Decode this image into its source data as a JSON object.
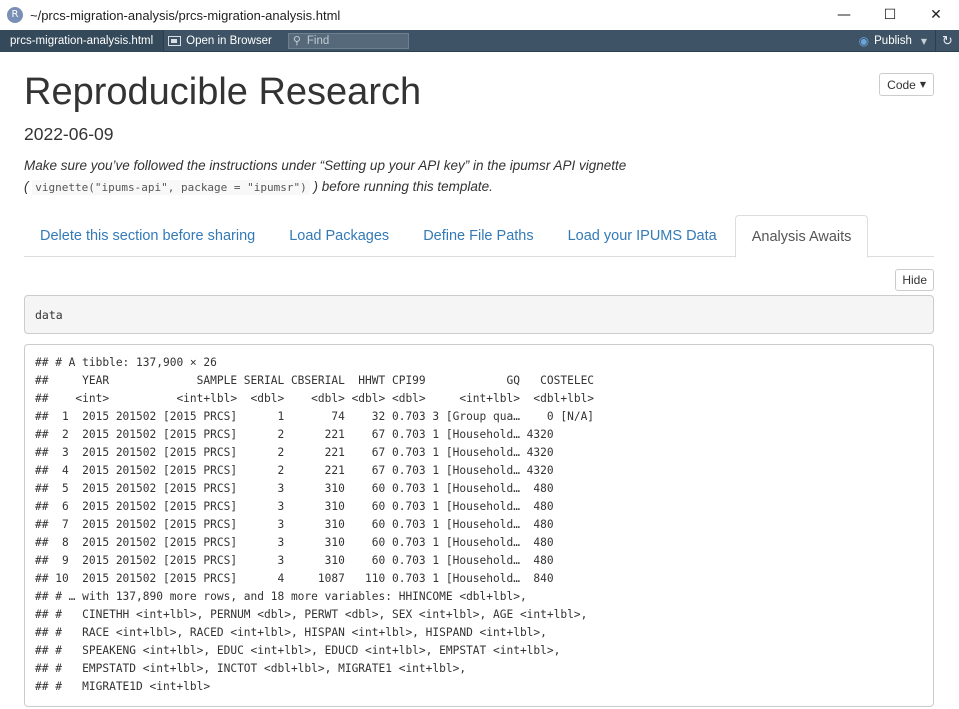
{
  "window": {
    "title": "~/prcs-migration-analysis/prcs-migration-analysis.html",
    "app_icon": "R",
    "minimize": "—",
    "maximize": "☐",
    "close": "✕"
  },
  "toolbar": {
    "file_tab": "prcs-migration-analysis.html",
    "open_in_browser": "Open in Browser",
    "find_placeholder": "Find",
    "publish": "Publish",
    "icons": {
      "open": "window-icon",
      "search": "search-icon",
      "publish": "publish-icon",
      "refresh": "refresh-icon"
    }
  },
  "document": {
    "title": "Reproducible Research",
    "date": "2022-06-09",
    "code_button": "Code",
    "note_before": "Make sure you’ve followed the instructions under “Setting up your API key” in the ipumsr API vignette",
    "note_open": "( ",
    "note_code": "vignette(\"ipums-api\", package = \"ipumsr\")",
    "note_after": " ) before running this template.",
    "tabs": [
      {
        "label": "Delete this section before sharing",
        "active": false
      },
      {
        "label": "Load Packages",
        "active": false
      },
      {
        "label": "Define File Paths",
        "active": false
      },
      {
        "label": "Load your IPUMS Data",
        "active": false
      },
      {
        "label": "Analysis Awaits",
        "active": true
      }
    ],
    "hide_button": "Hide",
    "code_chunk": "data",
    "output_lines": [
      "## # A tibble: 137,900 × 26",
      "##     YEAR             SAMPLE SERIAL CBSERIAL  HHWT CPI99            GQ   COSTELEC",
      "##    <int>          <int+lbl>  <dbl>    <dbl> <dbl> <dbl>     <int+lbl>  <dbl+lbl>",
      "##  1  2015 201502 [2015 PRCS]      1       74    32 0.703 3 [Group qua…    0 [N/A]",
      "##  2  2015 201502 [2015 PRCS]      2      221    67 0.703 1 [Household… 4320",
      "##  3  2015 201502 [2015 PRCS]      2      221    67 0.703 1 [Household… 4320",
      "##  4  2015 201502 [2015 PRCS]      2      221    67 0.703 1 [Household… 4320",
      "##  5  2015 201502 [2015 PRCS]      3      310    60 0.703 1 [Household…  480",
      "##  6  2015 201502 [2015 PRCS]      3      310    60 0.703 1 [Household…  480",
      "##  7  2015 201502 [2015 PRCS]      3      310    60 0.703 1 [Household…  480",
      "##  8  2015 201502 [2015 PRCS]      3      310    60 0.703 1 [Household…  480",
      "##  9  2015 201502 [2015 PRCS]      3      310    60 0.703 1 [Household…  480",
      "## 10  2015 201502 [2015 PRCS]      4     1087   110 0.703 1 [Household…  840",
      "## # … with 137,890 more rows, and 18 more variables: HHINCOME <dbl+lbl>,",
      "## #   CINETHH <int+lbl>, PERNUM <dbl>, PERWT <dbl>, SEX <int+lbl>, AGE <int+lbl>,",
      "## #   RACE <int+lbl>, RACED <int+lbl>, HISPAN <int+lbl>, HISPAND <int+lbl>,",
      "## #   SPEAKENG <int+lbl>, EDUC <int+lbl>, EDUCD <int+lbl>, EMPSTAT <int+lbl>,",
      "## #   EMPSTATD <int+lbl>, INCTOT <dbl+lbl>, MIGRATE1 <int+lbl>,",
      "## #   MIGRATE1D <int+lbl>"
    ]
  }
}
